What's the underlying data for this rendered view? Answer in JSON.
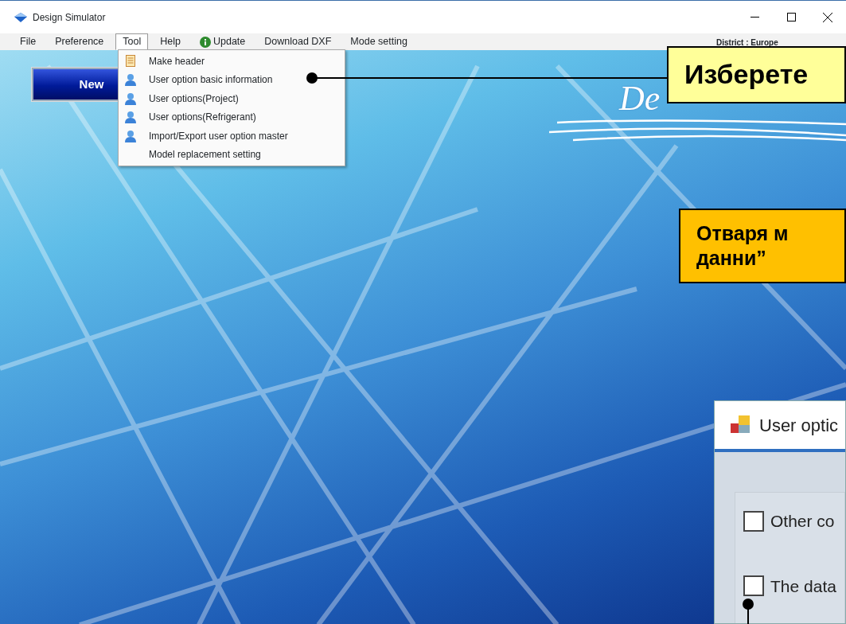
{
  "window": {
    "title": "Design Simulator"
  },
  "menubar": [
    {
      "label": "File",
      "open": false
    },
    {
      "label": "Preference",
      "open": false
    },
    {
      "label": "Tool",
      "open": true
    },
    {
      "label": "Help",
      "open": false
    },
    {
      "label": "Update",
      "open": false,
      "kind": "info"
    },
    {
      "label": "Download DXF",
      "open": false
    },
    {
      "label": "Mode setting",
      "open": false
    }
  ],
  "district": "District : Europe",
  "tool_menu": [
    {
      "label": "Make header",
      "kind": "document"
    },
    {
      "label": "User option basic information",
      "kind": "user"
    },
    {
      "label": "User options(Project)",
      "kind": "user"
    },
    {
      "label": "User options(Refrigerant)",
      "kind": "user"
    },
    {
      "label": "Import/Export user option master",
      "kind": "user"
    },
    {
      "label": "Model replacement setting",
      "kind": "plain"
    }
  ],
  "new_button": "New",
  "logo_text": "De",
  "callouts": [
    {
      "text_lines": [
        "Изберете"
      ],
      "color": "#ffff99"
    },
    {
      "text_lines": [
        "Отваря м",
        "данни”"
      ],
      "color": "#ffc000"
    }
  ],
  "dialog": {
    "title": "User optic",
    "checkboxes": [
      {
        "label": "Other co",
        "checked": false
      },
      {
        "label": "The data",
        "checked": false
      }
    ]
  }
}
